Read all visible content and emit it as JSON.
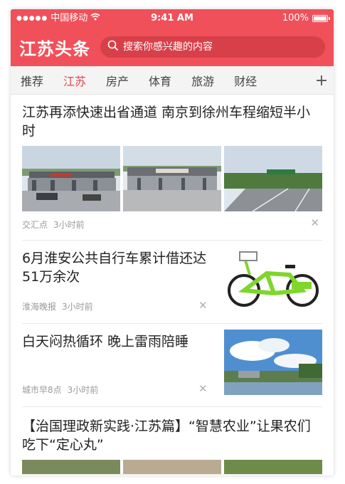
{
  "status_bar": {
    "carrier": "中国移动",
    "time": "9:41 AM",
    "battery": "100%"
  },
  "header": {
    "logo": "江苏头条",
    "search_placeholder": "搜索你感兴趣的内容"
  },
  "tabs": [
    {
      "label": "推荐",
      "active": false
    },
    {
      "label": "江苏",
      "active": true
    },
    {
      "label": "房产",
      "active": false
    },
    {
      "label": "体育",
      "active": false
    },
    {
      "label": "旅游",
      "active": false
    },
    {
      "label": "财经",
      "active": false
    }
  ],
  "tab_add": "+",
  "colors": {
    "brand": "#f0505a",
    "active_tab": "#e8454f",
    "meta_text": "#9a9a9a"
  },
  "feed": [
    {
      "title": "江苏再添快速出省通道 南京到徐州车程缩短半小时",
      "source": "交汇点",
      "time": "3小时前",
      "images": [
        "toll-station-photo",
        "toll-gate-photo",
        "highway-photo"
      ]
    },
    {
      "title": "6月淮安公共自行车累计借还达51万余次",
      "source": "淮海晚报",
      "time": "3小时前",
      "image": "green-bicycle-photo"
    },
    {
      "title": "白天闷热循环 晚上雷雨陪睡",
      "source": "城市早8点",
      "time": "3小时前",
      "image": "sky-landscape-photo"
    },
    {
      "title": "【治国理政新实践·江苏篇】“智慧农业”让果农们吃下“定心丸”"
    }
  ],
  "icons": {
    "search": "search-icon",
    "close": "close-icon",
    "wifi": "wifi-icon",
    "battery": "battery-icon",
    "add": "plus-icon"
  }
}
